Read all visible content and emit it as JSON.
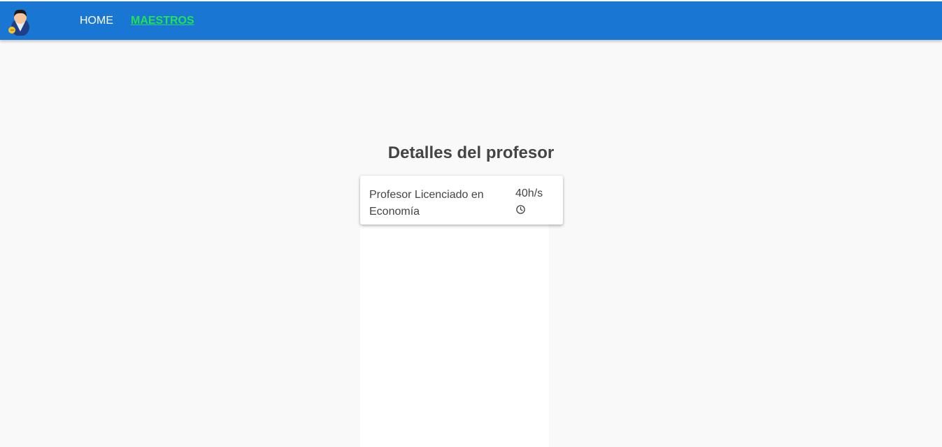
{
  "nav": {
    "logo_icon": "teacher-avatar-icon",
    "items": [
      {
        "label": "HOME",
        "active": false
      },
      {
        "label": "MAESTROS",
        "active": true
      }
    ]
  },
  "page": {
    "title": "Detalles del profesor"
  },
  "teacher_card": {
    "title": "Profesor Licenciado en Economía",
    "hours": "40h/s",
    "hours_icon": "clock-icon"
  },
  "colors": {
    "header": "#1976d2",
    "active_link": "#22e05a",
    "background": "#f9f9f9",
    "text": "#444444"
  }
}
